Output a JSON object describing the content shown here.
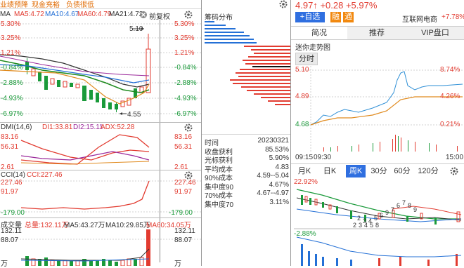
{
  "top_tags": [
    "业绩预降",
    "现金充裕",
    "负债很低"
  ],
  "ma_bar": {
    "name": "MA",
    "ma5": "MA5:4.72",
    "ma10": "MA10:4.67",
    "ma60": "MA60:4.79",
    "ma21": "MA21:4.72",
    "fq": "前复权"
  },
  "main_axis": [
    "5.30%",
    "3.25%",
    "1.21%",
    "-0.84%",
    "-2.88%",
    "-4.93%",
    "-6.97%"
  ],
  "high_mark": "5.10",
  "low_mark": "4.55",
  "chip": {
    "title": "筹码分布",
    "rows": [
      {
        "k": "时间",
        "v": "20230321"
      },
      {
        "k": "收盘获利",
        "v": "85.53%"
      },
      {
        "k": "光标获利",
        "v": "5.90%"
      },
      {
        "k": "平均成本",
        "v": "4.83"
      },
      {
        "k": "90%成本",
        "v": "4.59--5.04"
      },
      {
        "k": "集中度90",
        "v": "4.67%"
      },
      {
        "k": "70%成本",
        "v": "4.67--4.97"
      },
      {
        "k": "集中度70",
        "v": "3.11%"
      }
    ]
  },
  "dmi": {
    "name": "DMI(14,6)",
    "di1": "DI1:33.81",
    "di2": "DI2:15.11",
    "adx": "ADX:52.28",
    "axis": [
      "83.16",
      "56.31",
      "2.61"
    ]
  },
  "cci": {
    "name": "CCI(14)",
    "val": "CCI:227.46",
    "axis": [
      "227.46",
      "91.97",
      "-179.00"
    ]
  },
  "vol": {
    "name": "成交量",
    "total": "总量:132.11万",
    "ma5": "MA5:43.27万",
    "ma10": "MA10:29.85万",
    "ma60": "MA60:34.05万",
    "axis": [
      "132.11",
      "88.07",
      "万"
    ]
  },
  "quote": {
    "price": "4.97",
    "arrow": "↑",
    "change": "+0.28",
    "pct": "+5.97%",
    "add_label": "+自选",
    "rong": "融",
    "tong": "通",
    "sector": "互联网电商",
    "sector_pct": "+7.78%"
  },
  "tabs": [
    "简况",
    "推荐",
    "VIP盘口"
  ],
  "mini_title": "迷你走势图",
  "intraday": {
    "tab": "分时",
    "left_axis": [
      "5.10",
      "4.89",
      "4.68"
    ],
    "right_axis": [
      "8.74%",
      "4.26%",
      "0.21%"
    ],
    "times": [
      "09:15",
      "09:30",
      "15:00"
    ]
  },
  "period_tabs": [
    "月K",
    "日K",
    "周K",
    "30分",
    "60分",
    "120分"
  ],
  "weekly": {
    "top_pct": "22.92%",
    "bottom_pct": "-2.88%",
    "wave_labels": [
      "2",
      "3",
      "4",
      "5",
      "6",
      "7",
      "8",
      "9",
      "9",
      "7",
      "6",
      "5",
      "4",
      "3",
      "2",
      "8"
    ]
  }
}
